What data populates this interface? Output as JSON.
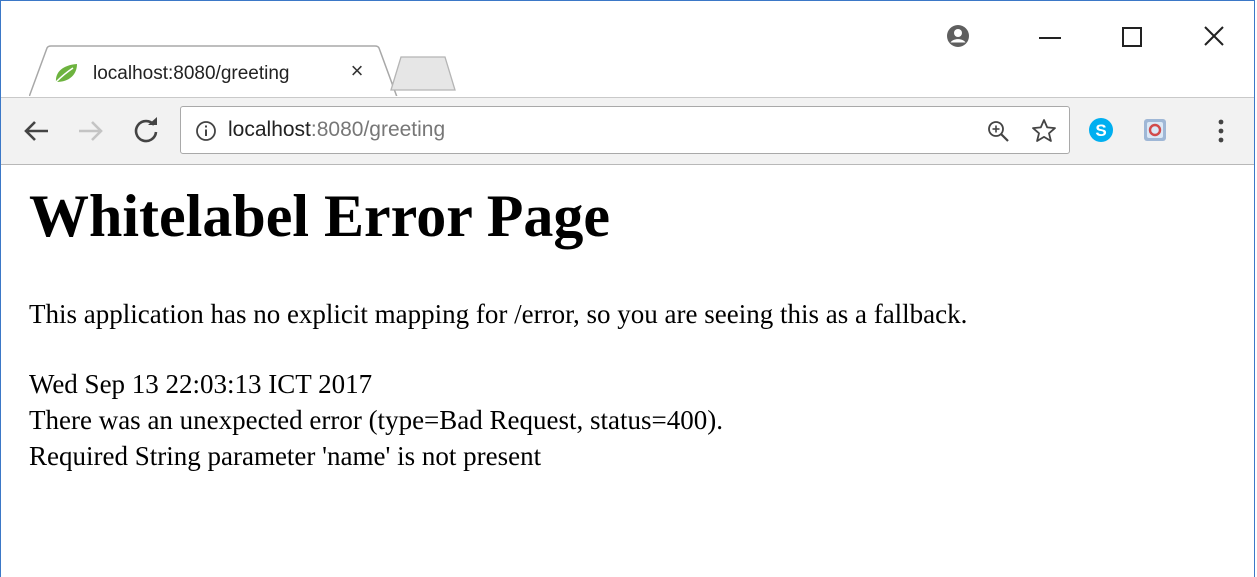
{
  "browser": {
    "tab": {
      "title": "localhost:8080/greeting",
      "close_glyph": "×"
    },
    "url": {
      "host": "localhost",
      "rest": ":8080/greeting"
    },
    "icons": {
      "favicon": "spring-leaf-icon",
      "profile": "profile-icon",
      "back": "back-arrow-icon",
      "forward": "forward-arrow-icon",
      "reload": "reload-icon",
      "info": "info-icon",
      "zoom": "zoom-icon",
      "bookmark": "star-icon",
      "ext1": "skype-icon",
      "ext2": "extension-icon",
      "menu": "menu-icon"
    },
    "colors": {
      "frame_border": "#3b78c7",
      "favicon": "#6db33f",
      "skype": "#00aff0"
    }
  },
  "page": {
    "title": "Whitelabel Error Page",
    "message": "This application has no explicit mapping for /error, so you are seeing this as a fallback.",
    "timestamp": "Wed Sep 13 22:03:13 ICT 2017",
    "error": "There was an unexpected error (type=Bad Request, status=400).",
    "detail": "Required String parameter 'name' is not present"
  }
}
